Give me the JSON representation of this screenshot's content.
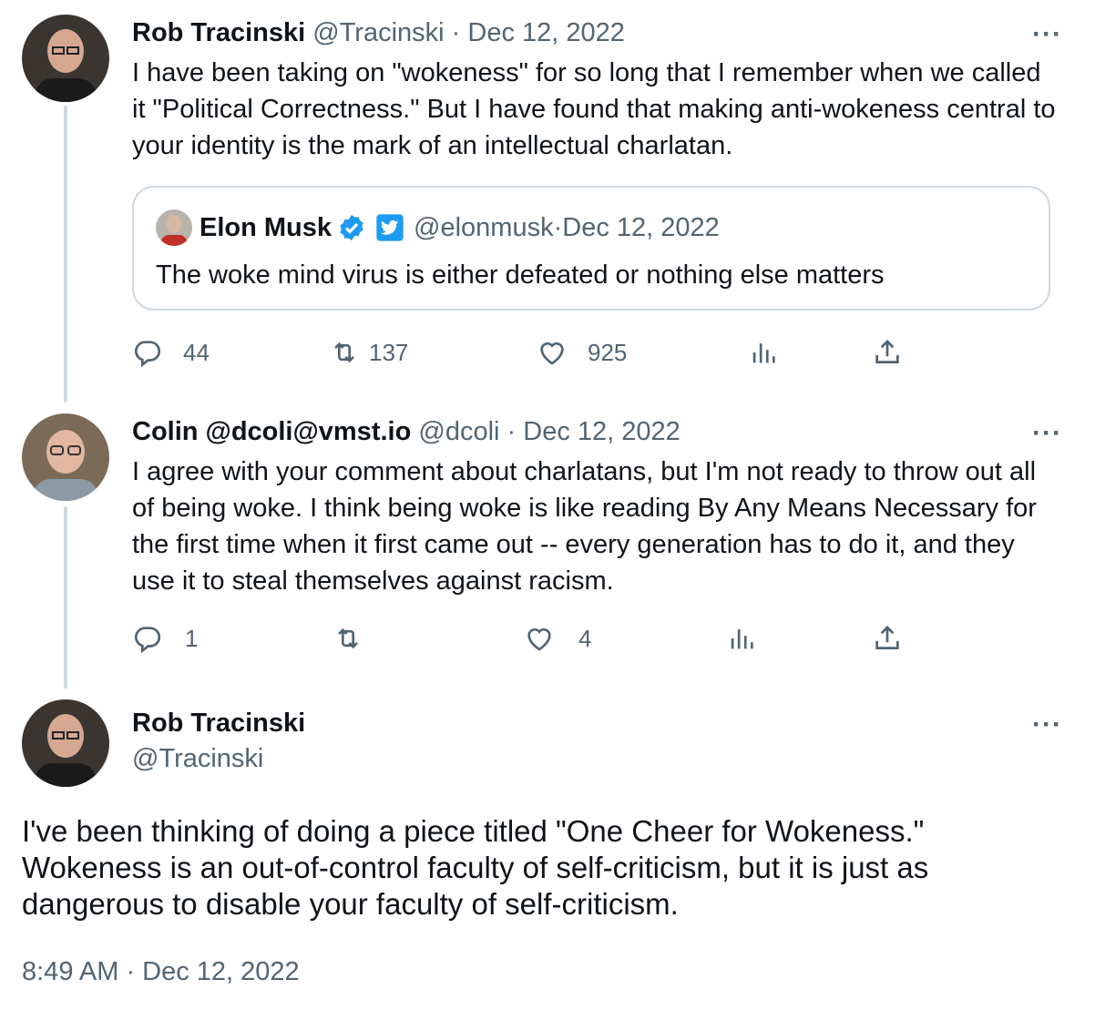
{
  "tweets": [
    {
      "author_name": "Rob Tracinski",
      "handle": "@Tracinski",
      "date": "Dec 12, 2022",
      "text": "I have been taking on \"wokeness\" for so long that I remember when we called it \"Political Correctness.\" But I have found that making anti-wokeness central to your identity is the mark of an intellectual charlatan.",
      "quote": {
        "author_name": "Elon Musk",
        "handle": "@elonmusk",
        "date": "Dec 12, 2022",
        "text": "The woke mind virus is either defeated or nothing else matters"
      },
      "counts": {
        "replies": "44",
        "retweets": "137",
        "likes": "925"
      }
    },
    {
      "author_name": "Colin @dcoli@vmst.io",
      "handle": "@dcoli",
      "date": "Dec 12, 2022",
      "text": "I agree with your comment about charlatans, but I'm not ready to throw out all of being woke. I think being woke is like reading By Any Means Necessary for the first time when it first came out -- every generation has to do it, and they use it to steal themselves against racism.",
      "counts": {
        "replies": "1",
        "retweets": "",
        "likes": "4"
      }
    }
  ],
  "main_tweet": {
    "author_name": "Rob Tracinski",
    "handle": "@Tracinski",
    "text": "I've been thinking of doing a piece titled \"One Cheer for Wokeness.\" Wokeness is an out-of-control faculty of self-criticism, but it is just as dangerous to disable your faculty of self-criticism.",
    "timestamp": "8:49 AM · Dec 12, 2022"
  },
  "ui": {
    "separator": " · ",
    "more": "···"
  },
  "icons": {
    "reply": "reply-icon",
    "retweet": "retweet-icon",
    "like": "heart-icon",
    "views": "views-icon",
    "share": "share-icon",
    "verified": "verified-badge-icon",
    "affiliate": "twitter-affiliate-icon"
  },
  "colors": {
    "text": "#0f1419",
    "secondary": "#536471",
    "border": "#cfd9de",
    "verified": "#1d9bf0"
  }
}
